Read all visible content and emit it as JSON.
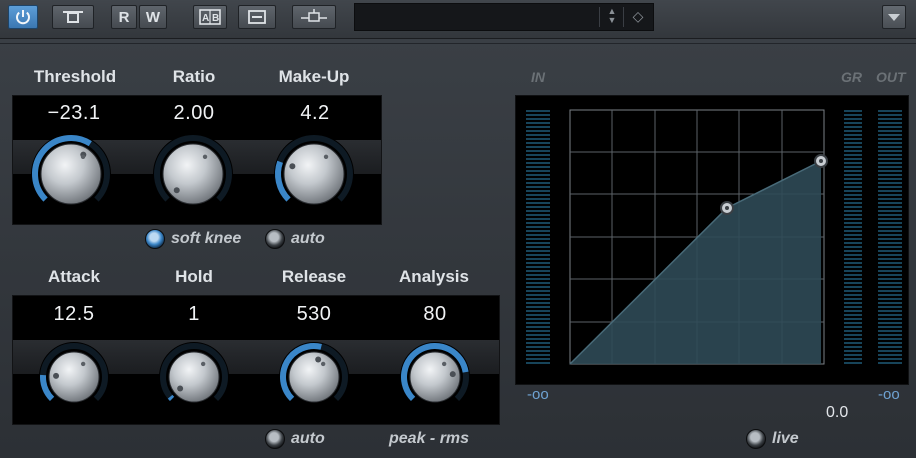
{
  "toolbar": {
    "buttons": [
      {
        "id": "power",
        "label": ""
      },
      {
        "id": "bypass",
        "label": ""
      },
      {
        "id": "read",
        "label": "R"
      },
      {
        "id": "write",
        "label": "W"
      },
      {
        "id": "ab",
        "label": ""
      },
      {
        "id": "list",
        "label": ""
      },
      {
        "id": "sidechain",
        "label": ""
      }
    ],
    "preset_name": ""
  },
  "controls": {
    "threshold": {
      "label": "Threshold",
      "value": "−23.1",
      "fill": 0.62
    },
    "ratio": {
      "label": "Ratio",
      "value": "2.00",
      "fill": 0.0
    },
    "makeup": {
      "label": "Make-Up",
      "value": "4.2",
      "fill": 0.24
    },
    "attack": {
      "label": "Attack",
      "value": "12.5",
      "fill": 0.18
    },
    "hold": {
      "label": "Hold",
      "value": "1",
      "fill": 0.02
    },
    "release": {
      "label": "Release",
      "value": "530",
      "fill": 0.55
    },
    "analysis": {
      "label": "Analysis",
      "value": "80",
      "fill": 0.8
    }
  },
  "options": {
    "soft_knee": {
      "label": "soft knee",
      "on": true
    },
    "auto_makeup": {
      "label": "auto",
      "on": false
    },
    "auto_release": {
      "label": "auto",
      "on": false
    },
    "analysis_mode": "peak - rms",
    "live": {
      "label": "live",
      "on": false
    }
  },
  "display": {
    "in_label": "IN",
    "gr_label": "GR",
    "out_label": "OUT",
    "in_scale": "-oo",
    "out_scale": "-oo",
    "gr_value": "0.0"
  },
  "colors": {
    "accent": "#3a86c8",
    "curve_fill": "#2f4a56",
    "meter": "#17445a"
  }
}
